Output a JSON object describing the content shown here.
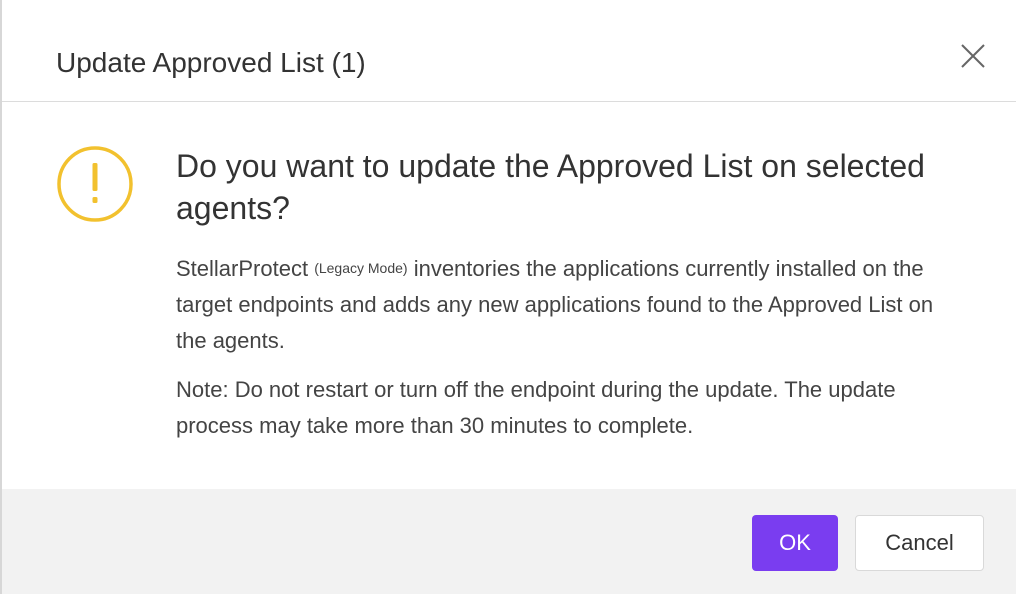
{
  "dialog": {
    "title": "Update Approved List (1)",
    "question": "Do you want to update the Approved List on selected agents?",
    "description": {
      "product": "StellarProtect",
      "mode": "(Legacy Mode)",
      "text": " inventories the applications currently installed on the target endpoints and adds any new applications found to the Approved List on the agents."
    },
    "note": "Note: Do not restart or turn off the endpoint during the update. The update process may take more than 30 minutes to complete.",
    "buttons": {
      "ok": "OK",
      "cancel": "Cancel"
    },
    "icons": {
      "close": "close-icon",
      "warning": "warning-icon"
    },
    "colors": {
      "accent": "#7a3df0",
      "warning": "#f2c12e",
      "footer_bg": "#f2f2f2"
    }
  }
}
